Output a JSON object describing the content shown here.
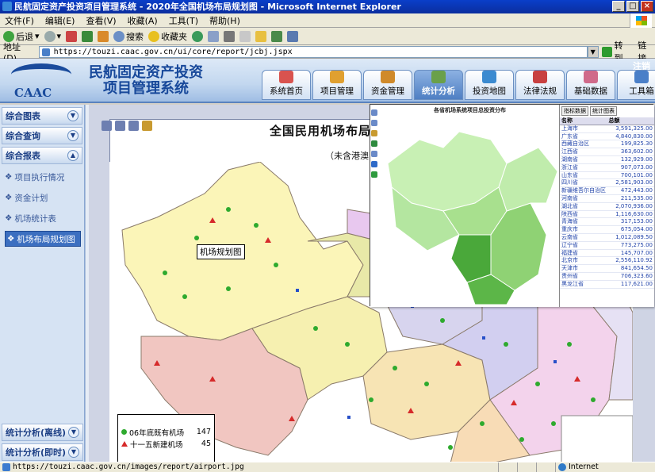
{
  "window": {
    "title": "民航固定资产投资项目管理系统 - 2020年全国机场布局规划图 - Microsoft Internet Explorer"
  },
  "menu": [
    "文件(F)",
    "编辑(E)",
    "查看(V)",
    "收藏(A)",
    "工具(T)",
    "帮助(H)"
  ],
  "toolbar": {
    "back": "后退",
    "search": "搜索",
    "favorites": "收藏夹"
  },
  "address": {
    "label": "地址(D)",
    "url": "https://touzi.caac.gov.cn/ui/core/report/jcbj.jspx",
    "go": "转到",
    "links": "链接"
  },
  "header": {
    "logo_text": "CAAC",
    "system_line1": "民航固定资产投资",
    "system_line2": "项目管理系统",
    "logout": "注销"
  },
  "nav": [
    {
      "label": "系统首页",
      "color": "#d9534f"
    },
    {
      "label": "项目管理",
      "color": "#e0a030"
    },
    {
      "label": "资金管理",
      "color": "#d08a2a"
    },
    {
      "label": "统计分析",
      "color": "#6aa04a"
    },
    {
      "label": "投资地图",
      "color": "#3b8ad0"
    },
    {
      "label": "法律法规",
      "color": "#c84040"
    },
    {
      "label": "基础数据",
      "color": "#d06a8a"
    },
    {
      "label": "工具箱",
      "color": "#4a7fc8"
    }
  ],
  "sidebar": {
    "sections": [
      "综合图表",
      "综合查询",
      "综合报表"
    ],
    "items": [
      "项目执行情况",
      "资金计划",
      "机场统计表",
      "机场布局规划图"
    ],
    "bottom": [
      "统计分析(离线)",
      "统计分析(即时)"
    ]
  },
  "report": {
    "title": "全国民用机场布局",
    "subtitle": "（未含港澳",
    "callout": "机场规划图",
    "legend": [
      {
        "label": "06年底既有机场",
        "count": "147",
        "color": "#2eaa2e"
      },
      {
        "label": "十一五新建机场",
        "count": "45",
        "color": "#d62a2a"
      }
    ]
  },
  "popup": {
    "title": "各省机场系统项目总投资分布",
    "tabs": [
      "指标数据",
      "统计图表"
    ],
    "columns": [
      "名称",
      "总额"
    ],
    "rows": [
      [
        "上海市",
        "3,591,325.00"
      ],
      [
        "广东省",
        "4,840,830.00"
      ],
      [
        "西藏自治区",
        "199,825.30"
      ],
      [
        "江西省",
        "363,602.00"
      ],
      [
        "湖南省",
        "132,929.00"
      ],
      [
        "浙江省",
        "907,073.00"
      ],
      [
        "山东省",
        "700,101.00"
      ],
      [
        "四川省",
        "2,581,903.00"
      ],
      [
        "新疆维吾尔自治区",
        "472,443.00"
      ],
      [
        "河南省",
        "211,535.00"
      ],
      [
        "湖北省",
        "2,070,936.00"
      ],
      [
        "陕西省",
        "1,116,630.00"
      ],
      [
        "青海省",
        "317,153.00"
      ],
      [
        "重庆市",
        "675,054.00"
      ],
      [
        "云南省",
        "1,012,089.50"
      ],
      [
        "辽宁省",
        "773,275.00"
      ],
      [
        "福建省",
        "145,707.00"
      ],
      [
        "北京市",
        "2,556,110.92"
      ],
      [
        "天津市",
        "841,654.50"
      ],
      [
        "贵州省",
        "706,323.60"
      ],
      [
        "黑龙江省",
        "117,621.00"
      ]
    ]
  },
  "status": {
    "url": "https://touzi.caac.gov.cn/images/report/airport.jpg",
    "zone": "Internet"
  }
}
